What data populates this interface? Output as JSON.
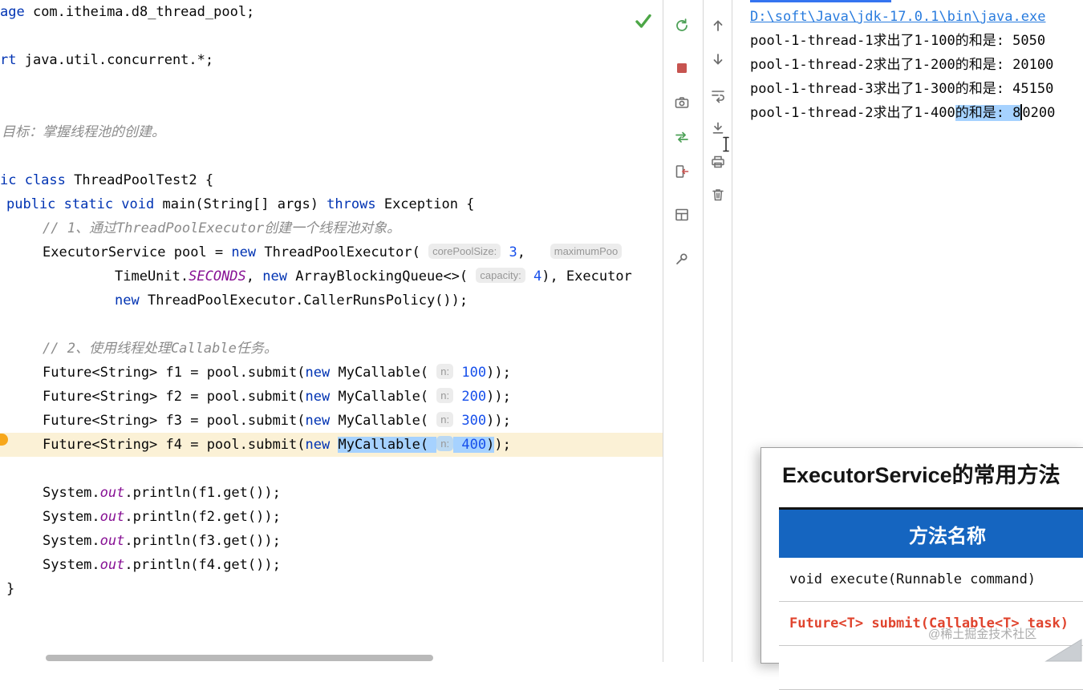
{
  "editor": {
    "no_problems_check": "✓",
    "lines": [
      {
        "ind": 0,
        "seg": [
          [
            "k",
            "age "
          ],
          [
            "p",
            "com.itheima.d8_thread_pool;"
          ]
        ]
      },
      {},
      {
        "ind": 0,
        "seg": [
          [
            "k",
            "rt "
          ],
          [
            "p",
            "java.util.concurrent.*;"
          ]
        ]
      },
      {},
      {},
      {
        "ind": 2,
        "seg": [
          [
            "c",
            "目标：掌握线程池的创建。"
          ]
        ]
      },
      {},
      {
        "ind": 0,
        "seg": [
          [
            "k",
            "ic class "
          ],
          [
            "p",
            "ThreadPoolTest2 {"
          ]
        ]
      },
      {
        "ind": 8,
        "seg": [
          [
            "k",
            "public static void "
          ],
          [
            "p",
            "main(String[] args) "
          ],
          [
            "k",
            "throws "
          ],
          [
            "p",
            "Exception {"
          ]
        ]
      },
      {
        "ind": 53,
        "seg": [
          [
            "c",
            "// 1、通过ThreadPoolExecutor创建一个线程池对象。"
          ]
        ]
      },
      {
        "ind": 53,
        "seg": [
          [
            "p",
            "ExecutorService pool = "
          ],
          [
            "k",
            "new "
          ],
          [
            "p",
            "ThreadPoolExecutor( "
          ],
          [
            "h",
            "corePoolSize:"
          ],
          [
            "p",
            " "
          ],
          [
            "n",
            "3"
          ],
          [
            "p",
            ",   "
          ],
          [
            "h",
            "maximumPoo"
          ]
        ]
      },
      {
        "ind": 143,
        "seg": [
          [
            "p",
            "TimeUnit."
          ],
          [
            "f",
            "SECONDS"
          ],
          [
            "p",
            ", "
          ],
          [
            "k",
            "new "
          ],
          [
            "p",
            "ArrayBlockingQueue<>( "
          ],
          [
            "h",
            "capacity:"
          ],
          [
            "p",
            " "
          ],
          [
            "n",
            "4"
          ],
          [
            "p",
            "), Executor"
          ]
        ]
      },
      {
        "ind": 143,
        "seg": [
          [
            "k",
            "new "
          ],
          [
            "p",
            "ThreadPoolExecutor.CallerRunsPolicy());"
          ]
        ]
      },
      {},
      {
        "ind": 53,
        "seg": [
          [
            "c",
            "// 2、使用线程处理Callable任务。"
          ]
        ]
      },
      {
        "ind": 53,
        "seg": [
          [
            "p",
            "Future<String> f1 = pool.submit("
          ],
          [
            "k",
            "new "
          ],
          [
            "p",
            "MyCallable( "
          ],
          [
            "h",
            "n:"
          ],
          [
            "p",
            " "
          ],
          [
            "n",
            "100"
          ],
          [
            "p",
            "));"
          ]
        ]
      },
      {
        "ind": 53,
        "seg": [
          [
            "p",
            "Future<String> f2 = pool.submit("
          ],
          [
            "k",
            "new "
          ],
          [
            "p",
            "MyCallable( "
          ],
          [
            "h",
            "n:"
          ],
          [
            "p",
            " "
          ],
          [
            "n",
            "200"
          ],
          [
            "p",
            "));"
          ]
        ]
      },
      {
        "ind": 53,
        "seg": [
          [
            "p",
            "Future<String> f3 = pool.submit("
          ],
          [
            "k",
            "new "
          ],
          [
            "p",
            "MyCallable( "
          ],
          [
            "h",
            "n:"
          ],
          [
            "p",
            " "
          ],
          [
            "n",
            "300"
          ],
          [
            "p",
            "));"
          ]
        ]
      },
      {
        "ind": 53,
        "cur": 1,
        "seg": [
          [
            "p",
            "Future<String> f4 = pool.submit("
          ],
          [
            "k",
            "new "
          ],
          [
            "p",
            "MyCallable( ",
            1
          ],
          [
            "h",
            "n:",
            1
          ],
          [
            "p",
            " ",
            1
          ],
          [
            "n",
            "400",
            1
          ],
          [
            "p",
            ")",
            1
          ],
          [
            "p",
            ");"
          ]
        ]
      },
      {},
      {
        "ind": 53,
        "seg": [
          [
            "p",
            "System."
          ],
          [
            "f",
            "out"
          ],
          [
            "p",
            ".println(f1.get());"
          ]
        ]
      },
      {
        "ind": 53,
        "seg": [
          [
            "p",
            "System."
          ],
          [
            "f",
            "out"
          ],
          [
            "p",
            ".println(f2.get());"
          ]
        ]
      },
      {
        "ind": 53,
        "seg": [
          [
            "p",
            "System."
          ],
          [
            "f",
            "out"
          ],
          [
            "p",
            ".println(f3.get());"
          ]
        ]
      },
      {
        "ind": 53,
        "seg": [
          [
            "p",
            "System."
          ],
          [
            "f",
            "out"
          ],
          [
            "p",
            ".println(f4.get());"
          ]
        ]
      },
      {
        "ind": 8,
        "seg": [
          [
            "p",
            "}"
          ]
        ]
      }
    ]
  },
  "run_toolbar": {
    "icons": [
      "rerun",
      "stop",
      "thread-dump-camera",
      "profiler",
      "exit",
      "restore-layout",
      "pin"
    ]
  },
  "console_toolbar": {
    "icons": [
      "prev-occurrence",
      "next-occurrence",
      "soft-wrap",
      "scroll-to-end",
      "print",
      "clear-all"
    ]
  },
  "console": {
    "lines": [
      {
        "seg": [
          [
            "link",
            "D:\\soft\\Java\\jdk-17.0.1\\bin\\java.exe"
          ]
        ]
      },
      {
        "seg": [
          [
            "p",
            "pool-1-thread-1求出了1-100的和是: 5050"
          ]
        ]
      },
      {
        "seg": [
          [
            "p",
            "pool-1-thread-2求出了1-200的和是: 20100"
          ]
        ]
      },
      {
        "seg": [
          [
            "p",
            "pool-1-thread-3求出了1-300的和是: 45150"
          ]
        ]
      },
      {
        "seg": [
          [
            "p",
            "pool-1-thread-2求出了1-400"
          ],
          [
            "psel",
            "的和是: 8"
          ],
          [
            "caret",
            ""
          ],
          [
            "p",
            "0200"
          ]
        ]
      }
    ]
  },
  "overlay": {
    "title": "ExecutorService的常用方法",
    "table": {
      "header": "方法名称",
      "rows": [
        {
          "text": "void execute(Runnable command)",
          "cls": "normal"
        },
        {
          "text": "Future<T> submit(Callable<T> task)",
          "cls": "red"
        },
        {
          "text": "",
          "cls": "normal"
        }
      ]
    },
    "watermark": "@稀土掘金技术社区"
  },
  "colors": {
    "selection": "#A6D2FF",
    "keyword": "#0033B3",
    "number": "#1750EB",
    "comment": "#8C8C8C",
    "static_field": "#871094",
    "link": "#287BDE",
    "table_header_blue": "#1565C0",
    "highlight_red": "#E0442E",
    "current_line": "#FBF1D6",
    "stop_red": "#C75450",
    "run_green": "#4DA157"
  }
}
